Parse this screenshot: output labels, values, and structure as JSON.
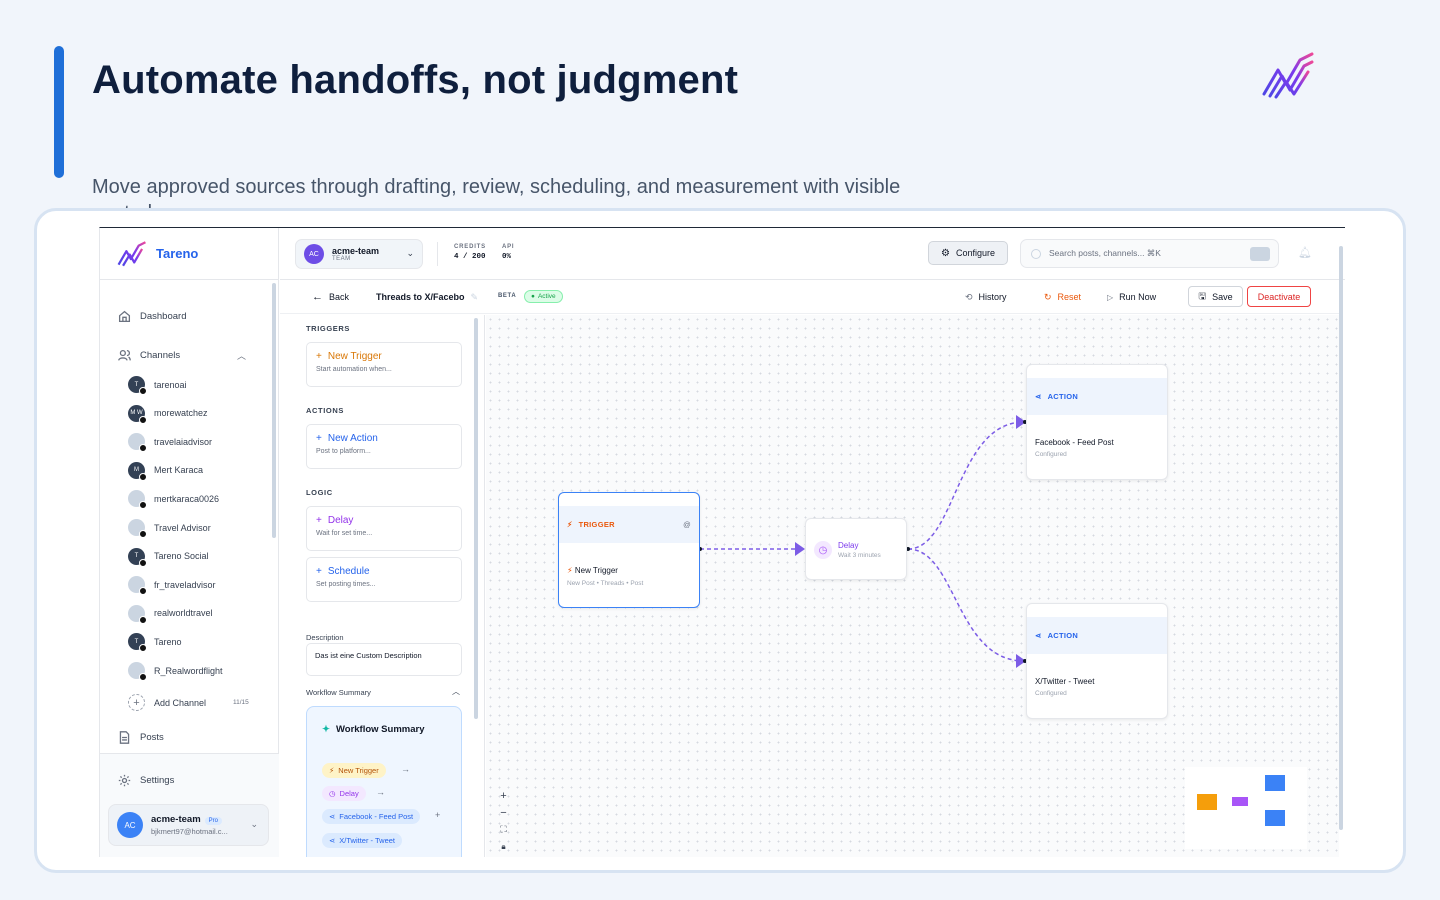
{
  "hero": {
    "title": "Automate handoffs, not judgment",
    "subtitle": "Move approved sources through drafting, review, scheduling, and measurement with visible controls."
  },
  "brand": {
    "name": "Tareno",
    "accent": "#2563eb"
  },
  "sidebar": {
    "nav": {
      "dashboard": "Dashboard",
      "channels": "Channels",
      "posts": "Posts",
      "settings": "Settings"
    },
    "channels": [
      {
        "name": "tarenoai",
        "avatar": "T"
      },
      {
        "name": "morewatchez",
        "avatar": "M W"
      },
      {
        "name": "travelaiadvisor",
        "avatar": ""
      },
      {
        "name": "Mert Karaca",
        "avatar": "M"
      },
      {
        "name": "mertkaraca0026",
        "avatar": ""
      },
      {
        "name": "Travel Advisor",
        "avatar": ""
      },
      {
        "name": "Tareno Social",
        "avatar": "T"
      },
      {
        "name": "fr_traveladvisor",
        "avatar": ""
      },
      {
        "name": "realworldtravel",
        "avatar": ""
      },
      {
        "name": "Tareno",
        "avatar": "T"
      },
      {
        "name": "R_Realwordflight",
        "avatar": ""
      }
    ],
    "add_channel": "Add Channel",
    "add_channel_count": "11/15",
    "account": {
      "initials": "AC",
      "name": "acme-team",
      "plan": "Pro",
      "email": "bjkmert97@hotmail.c..."
    }
  },
  "topbar": {
    "team": {
      "initials": "AC",
      "name": "acme-team",
      "role": "TEAM"
    },
    "credits_label": "CREDITS",
    "credits_value": "4 / 200",
    "api_label": "API",
    "api_value": "0%",
    "configure": "Configure",
    "search_placeholder": "Search posts, channels... ⌘K"
  },
  "toolbar": {
    "back": "Back",
    "workflow_name": "Threads to X/Facebo",
    "beta": "BETA",
    "status": "Active",
    "history": "History",
    "reset": "Reset",
    "run_now": "Run Now",
    "save": "Save",
    "deactivate": "Deactivate"
  },
  "palette": {
    "triggers_title": "TRIGGERS",
    "new_trigger": {
      "label": "New Trigger",
      "desc": "Start automation when..."
    },
    "actions_title": "ACTIONS",
    "new_action": {
      "label": "New Action",
      "desc": "Post to platform..."
    },
    "logic_title": "LOGIC",
    "delay": {
      "label": "Delay",
      "desc": "Wait for set time..."
    },
    "schedule": {
      "label": "Schedule",
      "desc": "Set posting times..."
    },
    "description_label": "Description",
    "description_value": "Das ist eine Custom Description",
    "summary_label": "Workflow Summary",
    "summary_card_title": "Workflow Summary",
    "summary_chips": [
      "New Trigger",
      "Delay",
      "Facebook - Feed Post",
      "X/Twitter - Tweet"
    ]
  },
  "canvas": {
    "trigger_node": {
      "header": "TRIGGER",
      "title": "New Trigger",
      "sub": "New Post • Threads • Post"
    },
    "delay_node": {
      "title": "Delay",
      "sub": "Wait 3 minutes"
    },
    "action_node_1": {
      "header": "ACTION",
      "title": "Facebook - Feed Post",
      "sub": "Configured"
    },
    "action_node_2": {
      "header": "ACTION",
      "title": "X/Twitter - Tweet",
      "sub": "Configured"
    },
    "colors": {
      "edge": "#7c5ce6",
      "trigger": "#f59e0b",
      "delay": "#a855f7",
      "action": "#2563eb"
    }
  }
}
